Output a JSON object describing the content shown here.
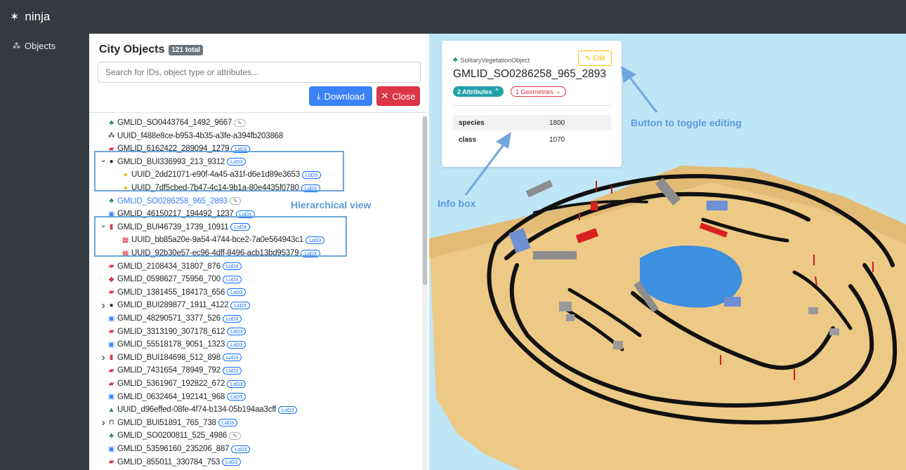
{
  "app": {
    "name": "ninja"
  },
  "sidebar": {
    "items": [
      {
        "label": "Objects",
        "icon": "objects-icon"
      }
    ]
  },
  "panel": {
    "title": "City Objects",
    "total_badge": "121 total",
    "search_placeholder": "Search for IDs, object type or attributes...",
    "download_label": "Download",
    "close_label": "Close"
  },
  "tree": [
    {
      "icon": "tree-icon",
      "label": "GMLID_SO0443764_1492_9667",
      "tag": "edit"
    },
    {
      "icon": "group-icon",
      "label": "UUID_f488e8ce-b953-4b35-a3fe-a394fb203868"
    },
    {
      "icon": "store-icon",
      "label": "GMLID_6162422_289094_1279",
      "tag": "LoD3"
    },
    {
      "icon": "building-circle-icon",
      "label": "GMLID_BUI336993_213_9312",
      "tag": "LoD3",
      "chevron": "down"
    },
    {
      "icon": "part-circle-icon",
      "label": "UUID_2dd21071-e90f-4a45-a31f-d6e1d89e3653",
      "tag": "LoD3",
      "indent": 1
    },
    {
      "icon": "part-circle-icon",
      "label": "UUID_7df5cbed-7b47-4c14-9b1a-80e4435f0780",
      "tag": "LoD3",
      "indent": 1
    },
    {
      "icon": "tree-icon",
      "label": "GMLID_SO0286258_965_2893",
      "tag": "edit",
      "active": true
    },
    {
      "icon": "bus-icon",
      "label": "GMLID_46150217_194492_1237",
      "tag": "LoD3"
    },
    {
      "icon": "building-icon",
      "label": "GMLID_BUI46739_1739_10911",
      "tag": "LoD3",
      "chevron": "down"
    },
    {
      "icon": "building-part-icon",
      "label": "UUID_bb85a20e-9a54-4744-bce2-7a0e564943c1",
      "tag": "LoD3",
      "indent": 1
    },
    {
      "icon": "building-part-icon",
      "label": "UUID_92b30e57-ec96-4dff-8496-acb13bd95379",
      "tag": "LoD3",
      "indent": 1
    },
    {
      "icon": "store-icon",
      "label": "GMLID_2108434_31807_876",
      "tag": "LoD3"
    },
    {
      "icon": "cube-icon",
      "label": "GMLID_0598627_75956_700",
      "tag": "LoD3"
    },
    {
      "icon": "store-icon",
      "label": "GMLID_1381455_184173_656",
      "tag": "LoD3"
    },
    {
      "icon": "building-circle-icon",
      "label": "GMLID_BUI289877_1911_4122",
      "tag": "LoD3",
      "chevron": "right"
    },
    {
      "icon": "bus-icon",
      "label": "GMLID_48290571_3377_526",
      "tag": "LoD3"
    },
    {
      "icon": "store-icon",
      "label": "GMLID_3313190_307178_612",
      "tag": "LoD3"
    },
    {
      "icon": "bus-icon",
      "label": "GMLID_55518178_9051_1323",
      "tag": "LoD3"
    },
    {
      "icon": "building-icon",
      "label": "GMLID_BUI184698_512_898",
      "tag": "LoD3",
      "chevron": "right"
    },
    {
      "icon": "store-icon",
      "label": "GMLID_7431654_78949_792",
      "tag": "LoD3"
    },
    {
      "icon": "store-icon",
      "label": "GMLID_5361967_192822_672",
      "tag": "LoD3"
    },
    {
      "icon": "bus-icon",
      "label": "GMLID_0632464_192141_968",
      "tag": "LoD3"
    },
    {
      "icon": "terrain-icon",
      "label": "UUID_d96effed-08fe-4f74-b134-05b194aa3cff",
      "tag": "LoD3"
    },
    {
      "icon": "gate-icon",
      "label": "GMLID_BUI51891_765_738",
      "tag": "LoD3",
      "chevron": "right"
    },
    {
      "icon": "tree-icon",
      "label": "GMLID_SO0200811_525_4986",
      "tag": "edit"
    },
    {
      "icon": "bus-icon",
      "label": "GMLID_53596160_235206_887",
      "tag": "LoD3"
    },
    {
      "icon": "store-icon",
      "label": "GMLID_855011_330784_753",
      "tag": "LoD3"
    }
  ],
  "lod_label": "LoD3",
  "infobox": {
    "type_label": "SolitaryVegetationObject",
    "object_id": "GMLID_SO0286258_965_2893",
    "edit_label": "Edit",
    "attributes_pill": "2 Attributes",
    "geometries_pill": "1 Geometries",
    "attributes": [
      {
        "key": "species",
        "value": "1800"
      },
      {
        "key": "class",
        "value": "1070"
      }
    ]
  },
  "annotations": {
    "hierarchical_view": "Hierarchical view",
    "info_box": "Info box",
    "toggle_editing": "Button to toggle editing"
  },
  "colors": {
    "accent_blue": "#3b82f6",
    "danger": "#dc3545",
    "callout": "#5b9bd9",
    "teal": "#20a0a8",
    "warning": "#ffc107",
    "navbar": "#343a40"
  }
}
